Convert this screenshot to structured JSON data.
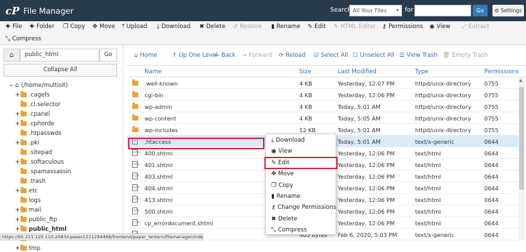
{
  "header": {
    "logo": "cP",
    "title": "File Manager",
    "search_label": "Search",
    "search_scope": "All Your Files",
    "for_label": "for",
    "go_label": "Go",
    "settings_label": "Settings"
  },
  "toolbar": {
    "file": "File",
    "folder": "Folder",
    "copy": "Copy",
    "move": "Move",
    "upload": "Upload",
    "download": "Download",
    "delete": "Delete",
    "restore": "Restore",
    "rename": "Rename",
    "edit": "Edit",
    "html_editor": "HTML Editor",
    "permissions": "Permissions",
    "view": "View",
    "extract": "Extract",
    "compress": "Compress"
  },
  "left": {
    "path_value": "public_html",
    "go_label": "Go",
    "collapse_label": "Collapse All",
    "tree": [
      {
        "label": "(/home/multisit)",
        "toggle": "–"
      },
      {
        "label": ".cagefs",
        "toggle": "+"
      },
      {
        "label": ".cl.selector",
        "toggle": ""
      },
      {
        "label": ".cpanel",
        "toggle": "+"
      },
      {
        "label": ".cphorde",
        "toggle": "+"
      },
      {
        "label": ".htpasswds",
        "toggle": ""
      },
      {
        "label": ".pki",
        "toggle": "+"
      },
      {
        "label": ".sitepad",
        "toggle": ""
      },
      {
        "label": ".softaculous",
        "toggle": "+"
      },
      {
        "label": ".spamassassin",
        "toggle": ""
      },
      {
        "label": ".trash",
        "toggle": ""
      },
      {
        "label": "etc",
        "toggle": "+"
      },
      {
        "label": "logs",
        "toggle": ""
      },
      {
        "label": "mail",
        "toggle": "+"
      },
      {
        "label": "public_ftp",
        "toggle": "+"
      },
      {
        "label": "public_html",
        "toggle": "+"
      },
      {
        "label": "ssl",
        "toggle": "+"
      },
      {
        "label": "tmp",
        "toggle": "+"
      }
    ]
  },
  "actions": {
    "home": "Home",
    "up": "Up One Level",
    "back": "Back",
    "forward": "Forward",
    "reload": "Reload",
    "select_all": "Select All",
    "unselect_all": "Unselect All",
    "view_trash": "View Trash",
    "empty_trash": "Empty Trash"
  },
  "columns": {
    "name": "Name",
    "size": "Size",
    "modified": "Last Modified",
    "type": "Type",
    "perms": "Permissions"
  },
  "files": [
    {
      "name": ".well-known",
      "size": "4 KB",
      "modified": "Yesterday, 12:07 PM",
      "type": "httpd/unix-directory",
      "perms": "0755"
    },
    {
      "name": "cgi-bin",
      "size": "4 KB",
      "modified": "Yesterday, 12:06 PM",
      "type": "httpd/unix-directory",
      "perms": "0755"
    },
    {
      "name": "wp-admin",
      "size": "4 KB",
      "modified": "Today, 5:01 AM",
      "type": "httpd/unix-directory",
      "perms": "0755"
    },
    {
      "name": "wp-content",
      "size": "4 KB",
      "modified": "Today, 5:05 AM",
      "type": "httpd/unix-directory",
      "perms": "0755"
    },
    {
      "name": "wp-includes",
      "size": "12 KB",
      "modified": "Today, 5:01 AM",
      "type": "httpd/unix-directory",
      "perms": "0755"
    },
    {
      "name": ".htaccess",
      "size": "",
      "modified": "Today, 5:01 AM",
      "type": "text/x-generic",
      "perms": "0644"
    },
    {
      "name": "400.shtml",
      "size": "",
      "modified": "Yesterday, 12:06 PM",
      "type": "text/html",
      "perms": "0644"
    },
    {
      "name": "401.shtml",
      "size": "",
      "modified": "Yesterday, 12:06 PM",
      "type": "text/html",
      "perms": "0644"
    },
    {
      "name": "403.shtml",
      "size": "",
      "modified": "Yesterday, 12:06 PM",
      "type": "text/html",
      "perms": "0644"
    },
    {
      "name": "404.shtml",
      "size": "",
      "modified": "Yesterday, 12:06 PM",
      "type": "text/html",
      "perms": "0644"
    },
    {
      "name": "413.shtml",
      "size": "",
      "modified": "Yesterday, 12:06 PM",
      "type": "text/html",
      "perms": "0644"
    },
    {
      "name": "500.shtml",
      "size": "",
      "modified": "Yesterday, 12:06 PM",
      "type": "text/html",
      "perms": "0644"
    },
    {
      "name": "cp_errordocument.shtml",
      "size": "",
      "modified": "Yesterday, 12:06 PM",
      "type": "text/html",
      "perms": "0644"
    },
    {
      "name": "",
      "size": "405 bytes",
      "modified": "Feb 6, 2020, 5:03 PM",
      "type": "text/x-generic",
      "perms": "0644"
    }
  ],
  "context_menu": [
    "Download",
    "View",
    "Edit",
    "Move",
    "Copy",
    "Rename",
    "Change Permissions",
    "Delete",
    "Compress"
  ],
  "status_url": "https://95.211.120.110:2083/cpsess1211294468/frontend/paper_lantern/filemanager/index.html#",
  "colors": {
    "header": "#293a4a",
    "link": "#2a6ebb",
    "folder": "#e8a33a",
    "highlight": "#d6293a",
    "selected_row": "#dbeaf7"
  }
}
